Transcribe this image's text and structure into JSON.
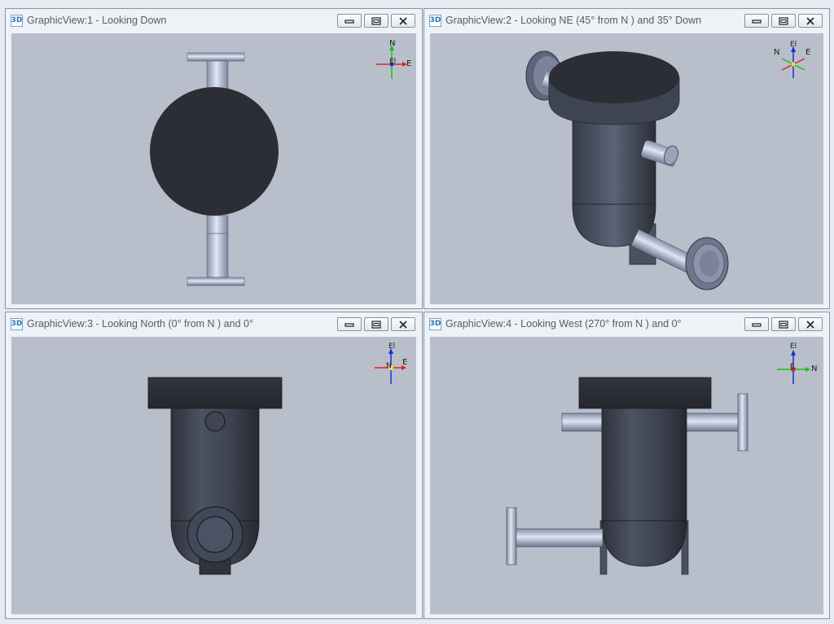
{
  "views": [
    {
      "title": "GraphicView:1 - Looking Down",
      "badge": "3D",
      "triad": {
        "n": "N",
        "e": "E",
        "el": "El"
      }
    },
    {
      "title": "GraphicView:2 - Looking NE (45° from N ) and 35° Down",
      "badge": "3D",
      "triad": {
        "n": "N",
        "e": "E",
        "el": "El"
      }
    },
    {
      "title": "GraphicView:3 - Looking North (0° from N ) and 0°",
      "badge": "3D",
      "triad": {
        "e": "E",
        "el": "El",
        "n": "N"
      }
    },
    {
      "title": "GraphicView:4 - Looking West (270° from N ) and 0°",
      "badge": "3D",
      "triad": {
        "n": "N",
        "el": "El",
        "e": "E"
      }
    }
  ],
  "icons": {
    "minimize": "minimize-icon",
    "restore": "restore-icon",
    "close": "close-icon"
  },
  "colors": {
    "viewport_bg": "#b8bfca",
    "vessel_dark": "#2b2e35",
    "pipe_light": "#c5cde0",
    "triad_x": "#e02020",
    "triad_y": "#18c018",
    "triad_z": "#1a2fd8"
  }
}
